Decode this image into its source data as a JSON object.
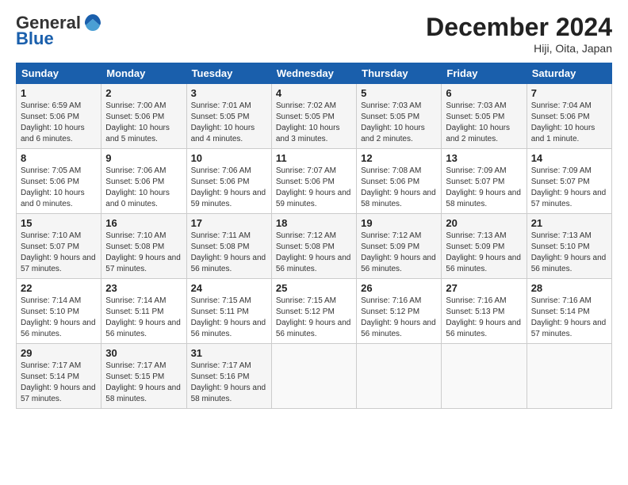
{
  "logo": {
    "general": "General",
    "blue": "Blue"
  },
  "header": {
    "month": "December 2024",
    "location": "Hiji, Oita, Japan"
  },
  "weekdays": [
    "Sunday",
    "Monday",
    "Tuesday",
    "Wednesday",
    "Thursday",
    "Friday",
    "Saturday"
  ],
  "weeks": [
    [
      {
        "day": "1",
        "sunrise": "6:59 AM",
        "sunset": "5:06 PM",
        "daylight": "10 hours and 6 minutes."
      },
      {
        "day": "2",
        "sunrise": "7:00 AM",
        "sunset": "5:06 PM",
        "daylight": "10 hours and 5 minutes."
      },
      {
        "day": "3",
        "sunrise": "7:01 AM",
        "sunset": "5:05 PM",
        "daylight": "10 hours and 4 minutes."
      },
      {
        "day": "4",
        "sunrise": "7:02 AM",
        "sunset": "5:05 PM",
        "daylight": "10 hours and 3 minutes."
      },
      {
        "day": "5",
        "sunrise": "7:03 AM",
        "sunset": "5:05 PM",
        "daylight": "10 hours and 2 minutes."
      },
      {
        "day": "6",
        "sunrise": "7:03 AM",
        "sunset": "5:05 PM",
        "daylight": "10 hours and 2 minutes."
      },
      {
        "day": "7",
        "sunrise": "7:04 AM",
        "sunset": "5:06 PM",
        "daylight": "10 hours and 1 minute."
      }
    ],
    [
      {
        "day": "8",
        "sunrise": "7:05 AM",
        "sunset": "5:06 PM",
        "daylight": "10 hours and 0 minutes."
      },
      {
        "day": "9",
        "sunrise": "7:06 AM",
        "sunset": "5:06 PM",
        "daylight": "10 hours and 0 minutes."
      },
      {
        "day": "10",
        "sunrise": "7:06 AM",
        "sunset": "5:06 PM",
        "daylight": "9 hours and 59 minutes."
      },
      {
        "day": "11",
        "sunrise": "7:07 AM",
        "sunset": "5:06 PM",
        "daylight": "9 hours and 59 minutes."
      },
      {
        "day": "12",
        "sunrise": "7:08 AM",
        "sunset": "5:06 PM",
        "daylight": "9 hours and 58 minutes."
      },
      {
        "day": "13",
        "sunrise": "7:09 AM",
        "sunset": "5:07 PM",
        "daylight": "9 hours and 58 minutes."
      },
      {
        "day": "14",
        "sunrise": "7:09 AM",
        "sunset": "5:07 PM",
        "daylight": "9 hours and 57 minutes."
      }
    ],
    [
      {
        "day": "15",
        "sunrise": "7:10 AM",
        "sunset": "5:07 PM",
        "daylight": "9 hours and 57 minutes."
      },
      {
        "day": "16",
        "sunrise": "7:10 AM",
        "sunset": "5:08 PM",
        "daylight": "9 hours and 57 minutes."
      },
      {
        "day": "17",
        "sunrise": "7:11 AM",
        "sunset": "5:08 PM",
        "daylight": "9 hours and 56 minutes."
      },
      {
        "day": "18",
        "sunrise": "7:12 AM",
        "sunset": "5:08 PM",
        "daylight": "9 hours and 56 minutes."
      },
      {
        "day": "19",
        "sunrise": "7:12 AM",
        "sunset": "5:09 PM",
        "daylight": "9 hours and 56 minutes."
      },
      {
        "day": "20",
        "sunrise": "7:13 AM",
        "sunset": "5:09 PM",
        "daylight": "9 hours and 56 minutes."
      },
      {
        "day": "21",
        "sunrise": "7:13 AM",
        "sunset": "5:10 PM",
        "daylight": "9 hours and 56 minutes."
      }
    ],
    [
      {
        "day": "22",
        "sunrise": "7:14 AM",
        "sunset": "5:10 PM",
        "daylight": "9 hours and 56 minutes."
      },
      {
        "day": "23",
        "sunrise": "7:14 AM",
        "sunset": "5:11 PM",
        "daylight": "9 hours and 56 minutes."
      },
      {
        "day": "24",
        "sunrise": "7:15 AM",
        "sunset": "5:11 PM",
        "daylight": "9 hours and 56 minutes."
      },
      {
        "day": "25",
        "sunrise": "7:15 AM",
        "sunset": "5:12 PM",
        "daylight": "9 hours and 56 minutes."
      },
      {
        "day": "26",
        "sunrise": "7:16 AM",
        "sunset": "5:12 PM",
        "daylight": "9 hours and 56 minutes."
      },
      {
        "day": "27",
        "sunrise": "7:16 AM",
        "sunset": "5:13 PM",
        "daylight": "9 hours and 56 minutes."
      },
      {
        "day": "28",
        "sunrise": "7:16 AM",
        "sunset": "5:14 PM",
        "daylight": "9 hours and 57 minutes."
      }
    ],
    [
      {
        "day": "29",
        "sunrise": "7:17 AM",
        "sunset": "5:14 PM",
        "daylight": "9 hours and 57 minutes."
      },
      {
        "day": "30",
        "sunrise": "7:17 AM",
        "sunset": "5:15 PM",
        "daylight": "9 hours and 58 minutes."
      },
      {
        "day": "31",
        "sunrise": "7:17 AM",
        "sunset": "5:16 PM",
        "daylight": "9 hours and 58 minutes."
      },
      null,
      null,
      null,
      null
    ]
  ]
}
